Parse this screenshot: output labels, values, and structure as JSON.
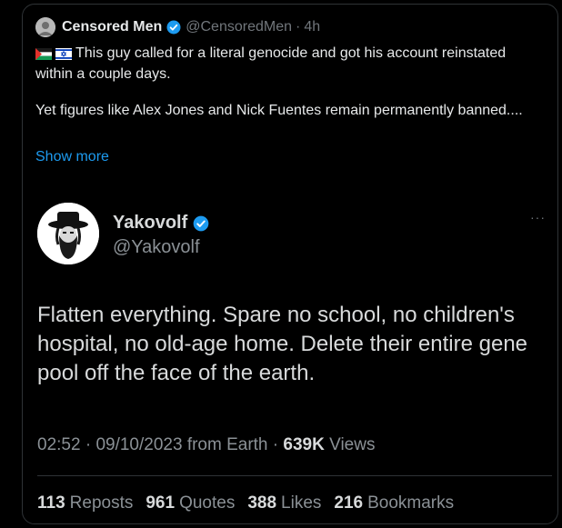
{
  "post": {
    "display_name": "Censored Men",
    "handle": "@CensoredMen",
    "separator": "·",
    "time": "4h",
    "text_line1": "This guy called for a literal genocide and got his account reinstated within a couple days.",
    "text_line2": "Yet figures like Alex Jones and Nick Fuentes remain permanently banned....",
    "show_more": "Show more",
    "flags": [
      "palestine-flag-icon",
      "israel-flag-icon"
    ]
  },
  "embed": {
    "display_name": "Yakovolf",
    "handle": "@Yakovolf",
    "more": "···",
    "text": "Flatten everything. Spare no school, no children's hospital, no old-age home. Delete their entire gene pool off the face of the earth.",
    "time": "02:52",
    "separator": "·",
    "date": "09/10/2023",
    "source": "from Earth",
    "views_count": "639K",
    "views_label": "Views",
    "stats": {
      "reposts_count": "113",
      "reposts_label": "Reposts",
      "quotes_count": "961",
      "quotes_label": "Quotes",
      "likes_count": "388",
      "likes_label": "Likes",
      "bookmarks_count": "216",
      "bookmarks_label": "Bookmarks"
    }
  },
  "colors": {
    "background": "#000000",
    "text": "#e7e9ea",
    "muted": "#71767b",
    "link": "#1d9bf0",
    "verified": "#1d9bf0",
    "border": "#2f3336"
  }
}
